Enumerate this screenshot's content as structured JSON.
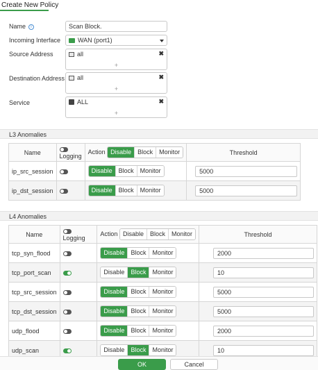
{
  "page": {
    "title": "Create New Policy"
  },
  "form": {
    "name_label": "Name",
    "name_value": "Scan Block.",
    "incoming_label": "Incoming Interface",
    "incoming_value": "WAN (port1)",
    "source_label": "Source Address",
    "source_value": "all",
    "dest_label": "Destination Address",
    "dest_value": "all",
    "service_label": "Service",
    "service_value": "ALL",
    "add_symbol": "+",
    "remove_symbol": "✖"
  },
  "l3": {
    "section_title": "L3 Anomalies",
    "headers": {
      "name": "Name",
      "logging": "Logging",
      "action": "Action",
      "threshold": "Threshold"
    },
    "header_actions": [
      "Disable",
      "Block",
      "Monitor"
    ],
    "header_active": 0,
    "rows": [
      {
        "name": "ip_src_session",
        "logging": false,
        "actions": [
          "Disable",
          "Block",
          "Monitor"
        ],
        "active": 0,
        "threshold": "5000"
      },
      {
        "name": "ip_dst_session",
        "logging": false,
        "actions": [
          "Disable",
          "Block",
          "Monitor"
        ],
        "active": 0,
        "threshold": "5000"
      }
    ]
  },
  "l4": {
    "section_title": "L4 Anomalies",
    "headers": {
      "name": "Name",
      "logging": "Logging",
      "action": "Action",
      "threshold": "Threshold"
    },
    "header_actions": [
      "Disable",
      "Block",
      "Monitor"
    ],
    "rows": [
      {
        "name": "tcp_syn_flood",
        "logging": false,
        "actions": [
          "Disable",
          "Block",
          "Monitor"
        ],
        "active": 0,
        "threshold": "2000"
      },
      {
        "name": "tcp_port_scan",
        "logging": true,
        "actions": [
          "Disable",
          "Block",
          "Monitor"
        ],
        "active": 1,
        "threshold": "10"
      },
      {
        "name": "tcp_src_session",
        "logging": false,
        "actions": [
          "Disable",
          "Block",
          "Monitor"
        ],
        "active": 0,
        "threshold": "5000"
      },
      {
        "name": "tcp_dst_session",
        "logging": false,
        "actions": [
          "Disable",
          "Block",
          "Monitor"
        ],
        "active": 0,
        "threshold": "5000"
      },
      {
        "name": "udp_flood",
        "logging": false,
        "actions": [
          "Disable",
          "Block",
          "Monitor"
        ],
        "active": 0,
        "threshold": "2000"
      },
      {
        "name": "udp_scan",
        "logging": true,
        "actions": [
          "Disable",
          "Block",
          "Monitor"
        ],
        "active": 1,
        "threshold": "10"
      }
    ]
  },
  "footer": {
    "ok_label": "OK",
    "cancel_label": "Cancel"
  },
  "colors": {
    "accent": "#3a9c4a"
  }
}
